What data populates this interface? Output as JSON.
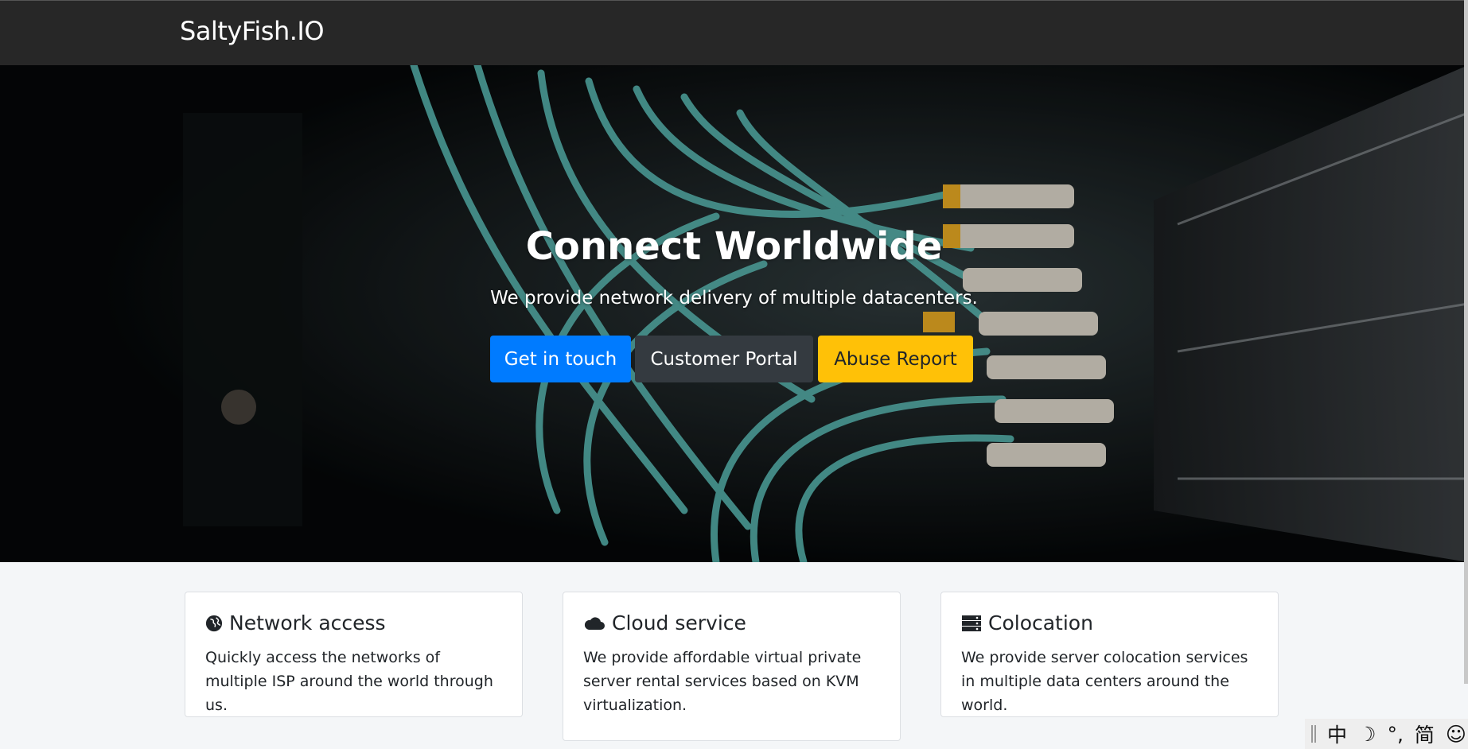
{
  "navbar": {
    "brand": "SaltyFish.IO"
  },
  "hero": {
    "title": "Connect Worldwide",
    "subtitle": "We provide network delivery of multiple datacenters.",
    "buttons": [
      {
        "label": "Get in touch",
        "color": "#007bff"
      },
      {
        "label": "Customer Portal",
        "color": "#343a40"
      },
      {
        "label": "Abuse Report",
        "color": "#ffc107"
      }
    ]
  },
  "features": [
    {
      "icon": "globe-icon",
      "title": "Network access",
      "text": "Quickly access the networks of multiple ISP around the world through us."
    },
    {
      "icon": "cloud-icon",
      "title": "Cloud service",
      "text": "We provide affordable virtual private server rental services based on KVM virtualization."
    },
    {
      "icon": "server-icon",
      "title": "Colocation",
      "text": "We provide server colocation services in multiple data centers around the world."
    }
  ],
  "ime_toolbar": {
    "items": [
      "中",
      "☽",
      "°,",
      "简",
      "☺"
    ]
  }
}
